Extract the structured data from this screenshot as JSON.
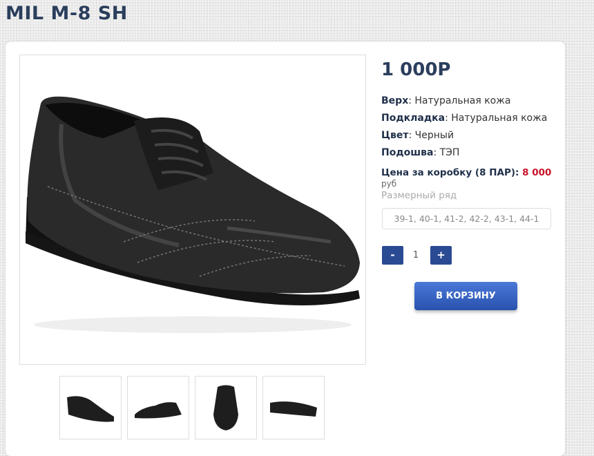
{
  "product": {
    "title": "MIL M-8 SH",
    "price": "1 000P",
    "specs": [
      {
        "label": "Верх",
        "value": "Натуральная кожа"
      },
      {
        "label": "Подкладка",
        "value": "Натуральная кожа"
      },
      {
        "label": "Цвет",
        "value": "Черный"
      },
      {
        "label": "Подошва",
        "value": "ТЭП"
      }
    ],
    "box_price_label": "Цена за коробку (8 ПАР):",
    "box_price_value": "8 000",
    "box_price_currency": "руб",
    "size_label": "Размерный ряд",
    "size_value": "39-1, 40-1, 41-2, 42-2, 43-1, 44-1",
    "qty_minus": "-",
    "qty_value": "1",
    "qty_plus": "+",
    "cart_button": "В КОРЗИНУ"
  },
  "colors": {
    "title": "#2b3e5c",
    "accent_blue": "#2a4a93",
    "box_price_red": "#c8152b"
  }
}
